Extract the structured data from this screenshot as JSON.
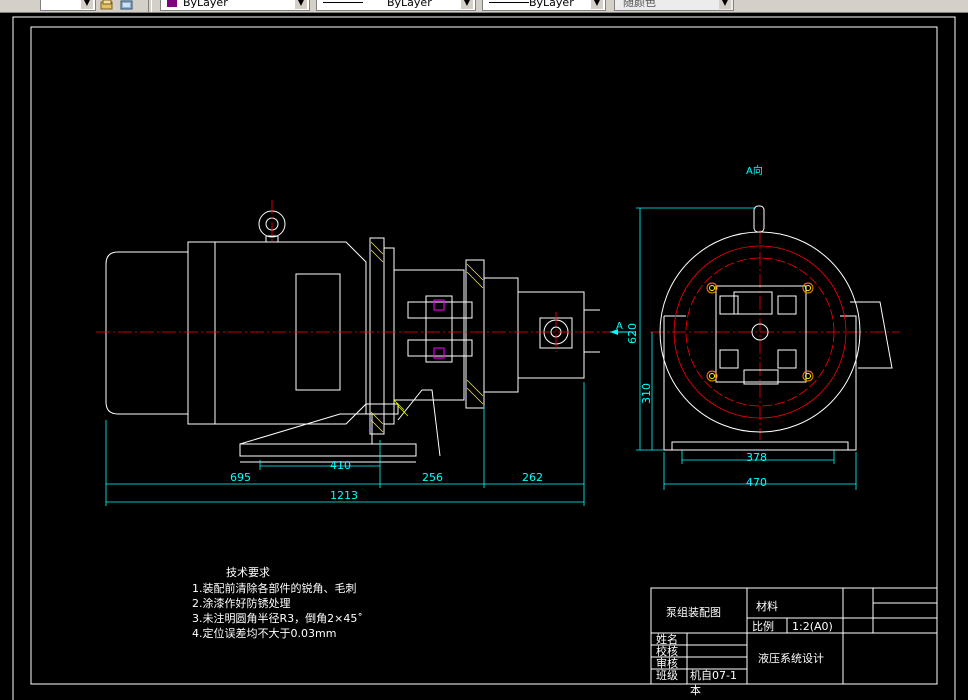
{
  "toolbar": {
    "arrow_glyph": "▼",
    "color_value": "ByLayer",
    "linetype_value": "ByLayer",
    "lineweight_value": "ByLayer",
    "plotstyle_value": "随颜色",
    "layer_icon_1": "layer-states-icon",
    "layer_icon_2": "layer-previous-icon",
    "accent_color": "#800080"
  },
  "drawing": {
    "view_label": "A向",
    "section_label": "A",
    "dims": {
      "d695": "695",
      "d410": "410",
      "d256": "256",
      "d262": "262",
      "d1213": "1213",
      "d378": "378",
      "d470": "470",
      "d310": "310",
      "d620": "620"
    },
    "tech_title": "技术要求",
    "tech_items": [
      "1.装配前清除各部件的锐角、毛刺",
      "2.涂漆作好防锈处理",
      "3.未注明圆角半径R3，倒角2×45˚",
      "4.定位误差均不大于0.03mm"
    ]
  },
  "title_block": {
    "drawing_name": "泵组装配图",
    "material_label": "材料",
    "scale_label": "比例",
    "scale_value": "1:2(A0)",
    "name_label": "姓名",
    "check_label": "校核",
    "review_label": "审核",
    "class_label": "班级",
    "class_value": "机自07-1",
    "class_value_2": "本",
    "project": "液压系统设计"
  },
  "colors": {
    "outline": "#ffffff",
    "dimension": "#00ffff",
    "centerline": "#ff0000",
    "hatch": "#ffff00",
    "highlight": "#ff00ff",
    "bolt": "#ff8000"
  }
}
